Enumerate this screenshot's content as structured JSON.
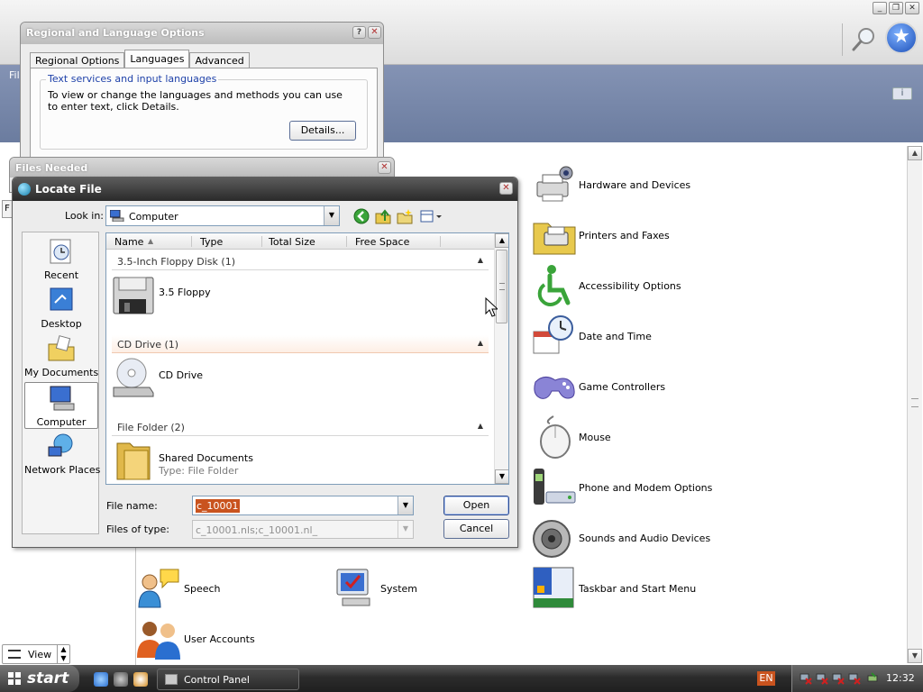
{
  "control_panel": {
    "menu_file": "File",
    "items": [
      {
        "label": "Hardware and Devices",
        "icon": "printer-camera-icon"
      },
      {
        "label": "Printers and Faxes",
        "icon": "printer-folder-icon"
      },
      {
        "label": "Accessibility Options",
        "icon": "accessibility-icon"
      },
      {
        "label": "Date and Time",
        "icon": "clock-calendar-icon"
      },
      {
        "label": "Game Controllers",
        "icon": "gamepad-icon"
      },
      {
        "label": "Mouse",
        "icon": "mouse-icon"
      },
      {
        "label": "Phone and Modem Options",
        "icon": "phone-modem-icon"
      },
      {
        "label": "Sounds and Audio Devices",
        "icon": "speaker-icon"
      },
      {
        "label": "Speech",
        "icon": "speech-icon"
      },
      {
        "label": "System",
        "icon": "system-icon"
      },
      {
        "label": "Taskbar and Start Menu",
        "icon": "taskbar-icon"
      },
      {
        "label": "User Accounts",
        "icon": "user-accounts-icon"
      }
    ],
    "view_label": "View"
  },
  "regional": {
    "title": "Regional and Language Options",
    "tabs": [
      "Regional Options",
      "Languages",
      "Advanced"
    ],
    "active_tab": "Languages",
    "group_label": "Text services and input languages",
    "group_text": "To view or change the languages and methods you can use to enter text, click Details.",
    "details_button": "Details..."
  },
  "files_needed": {
    "title": "Files Needed"
  },
  "locate": {
    "title": "Locate File",
    "look_in_label": "Look in:",
    "look_in_value": "Computer",
    "places": [
      "Recent",
      "Desktop",
      "My Documents",
      "Computer",
      "Network Places"
    ],
    "selected_place": "Computer",
    "columns": [
      "Name",
      "Type",
      "Total Size",
      "Free Space"
    ],
    "groups": [
      {
        "header": "3.5-Inch Floppy Disk (1)",
        "items": [
          {
            "name": "3.5 Floppy",
            "sub": ""
          }
        ]
      },
      {
        "header": "CD Drive (1)",
        "items": [
          {
            "name": "CD Drive",
            "sub": ""
          }
        ]
      },
      {
        "header": "File Folder (2)",
        "items": [
          {
            "name": "Shared Documents",
            "sub": "Type: File Folder"
          }
        ]
      }
    ],
    "file_name_label": "File name:",
    "file_name_value": "c_10001",
    "files_of_type_label": "Files of type:",
    "files_of_type_value": "c_10001.nls;c_10001.nl_",
    "open_button": "Open",
    "cancel_button": "Cancel"
  },
  "taskbar": {
    "start_label": "start",
    "task_label": "Control Panel",
    "lang": "EN",
    "clock": "12:32"
  },
  "colors": {
    "selection_accent": "#c9531e",
    "header_band": "#7b8aab"
  }
}
